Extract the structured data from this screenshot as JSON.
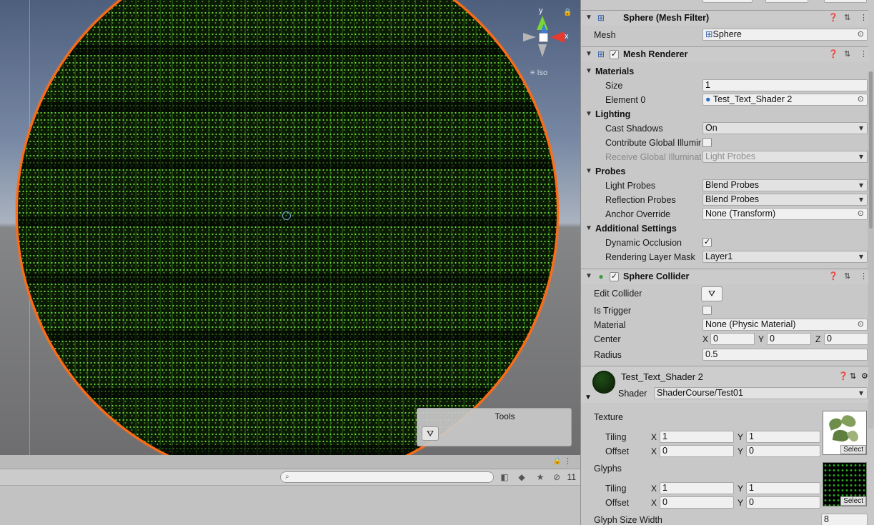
{
  "scene": {
    "gizmo": {
      "y_label": "y",
      "x_label": "x",
      "projection": "Iso"
    },
    "tools_overlay": {
      "title": "Tools"
    }
  },
  "lower_panel": {
    "search_placeholder": "",
    "hidden_count": "11"
  },
  "inspector": {
    "mesh_filter": {
      "title": "Sphere (Mesh Filter)",
      "mesh_label": "Mesh",
      "mesh_value": "Sphere"
    },
    "mesh_renderer": {
      "title": "Mesh Renderer",
      "materials_section": "Materials",
      "size_label": "Size",
      "size_value": "1",
      "element0_label": "Element 0",
      "element0_value": "Test_Text_Shader 2",
      "lighting_section": "Lighting",
      "cast_shadows_label": "Cast Shadows",
      "cast_shadows_value": "On",
      "contrib_gi_label": "Contribute Global Illumin",
      "receive_gi_label": "Receive Global Illuminat",
      "receive_gi_value": "Light Probes",
      "probes_section": "Probes",
      "light_probes_label": "Light Probes",
      "light_probes_value": "Blend Probes",
      "reflection_probes_label": "Reflection Probes",
      "reflection_probes_value": "Blend Probes",
      "anchor_override_label": "Anchor Override",
      "anchor_override_value": "None (Transform)",
      "additional_section": "Additional Settings",
      "dynamic_occlusion_label": "Dynamic Occlusion",
      "rendering_layer_label": "Rendering Layer Mask",
      "rendering_layer_value": "Layer1"
    },
    "sphere_collider": {
      "title": "Sphere Collider",
      "edit_collider_label": "Edit Collider",
      "is_trigger_label": "Is Trigger",
      "material_label": "Material",
      "material_value": "None (Physic Material)",
      "center_label": "Center",
      "center_x": "0",
      "center_y": "0",
      "center_z": "0",
      "radius_label": "Radius",
      "radius_value": "0.5"
    },
    "material": {
      "title": "Test_Text_Shader 2",
      "shader_label": "Shader",
      "shader_value": "ShaderCourse/Test01",
      "texture_label": "Texture",
      "tiling_label": "Tiling",
      "offset_label": "Offset",
      "tex_tiling_x": "1",
      "tex_tiling_y": "1",
      "tex_offset_x": "0",
      "tex_offset_y": "0",
      "glyphs_label": "Glyphs",
      "gly_tiling_x": "1",
      "gly_tiling_y": "1",
      "gly_offset_x": "0",
      "gly_offset_y": "0",
      "select_label": "Select",
      "glyph_size_width_label": "Glyph Size Width",
      "glyph_size_width_value": "8"
    },
    "axis_labels": {
      "x": "X",
      "y": "Y",
      "z": "Z"
    }
  }
}
